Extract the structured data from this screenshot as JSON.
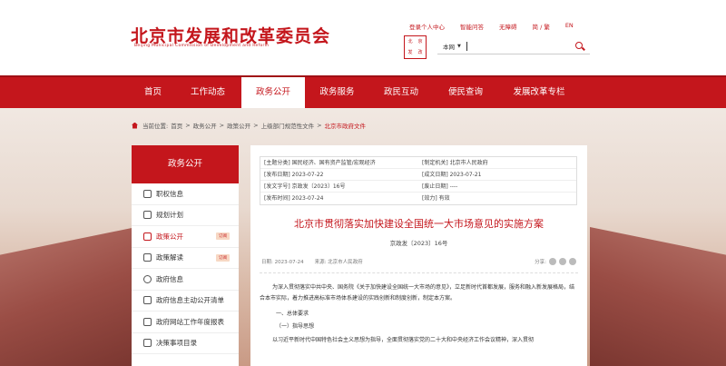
{
  "header": {
    "title": "北京市发展和改革委员会",
    "subtitle": "Beijing Municipal Commission of Development and Reform",
    "top_links": [
      "登录个人中心",
      "智能问答",
      "无障碍",
      "简 / 繁",
      "EN"
    ],
    "seal_text": [
      "北",
      "京",
      "发",
      "改"
    ]
  },
  "search": {
    "scope": "本网",
    "placeholder": ""
  },
  "nav": {
    "items": [
      "首页",
      "工作动态",
      "政务公开",
      "政务服务",
      "政民互动",
      "便民查询",
      "发展改革专栏"
    ],
    "active_index": 2
  },
  "breadcrumb": {
    "label": "当前位置:",
    "items": [
      "首页",
      "政务公开",
      "政策公开",
      "上级部门规范性文件",
      "北京市政府文件"
    ]
  },
  "sidebar": {
    "title": "政务公开",
    "items": [
      {
        "label": "职权信息",
        "badge": ""
      },
      {
        "label": "规划计划",
        "badge": ""
      },
      {
        "label": "政策公开",
        "badge": "订阅",
        "active": true
      },
      {
        "label": "政策解读",
        "badge": "订阅"
      },
      {
        "label": "政府信息",
        "badge": ""
      },
      {
        "label": "政府信息主动公开清单",
        "badge": ""
      },
      {
        "label": "政府网站工作年度报表",
        "badge": ""
      },
      {
        "label": "决策事项目录",
        "badge": ""
      }
    ]
  },
  "meta": {
    "rows": [
      [
        "[主题分类] 国民经济、国有资产监管/宏观经济",
        "[制定机关] 北京市人民政府"
      ],
      [
        "[发布日期] 2023-07-22",
        "[成文日期] 2023-07-21"
      ],
      [
        "[发文字号] 京政发〔2023〕16号",
        "[废止日期] ----"
      ],
      [
        "[发布时间] 2023-07-24",
        "[效力] 有效"
      ]
    ]
  },
  "document": {
    "title": "北京市贯彻落实加快建设全国统一大市场意见的实施方案",
    "number": "京政发〔2023〕16号",
    "date": "日期: 2023-07-24",
    "source": "来源: 北京市人民政府",
    "share_label": "分享:",
    "intro": "为深入贯彻落实中共中央、国务院《关于加快建设全国统一大市场的意见》，立足新时代首都发展，服务和融入新发展格局，结合本市实际，着力推进高标准市场体系建设的实践创新和制度创新，制定本方案。",
    "section1": "一、总体要求",
    "section1_1": "（一）指导思想",
    "body": "以习近平新时代中国特色社会主义思想为指导，全面贯彻落实党的二十大和中央经济工作会议精神，深入贯彻"
  }
}
